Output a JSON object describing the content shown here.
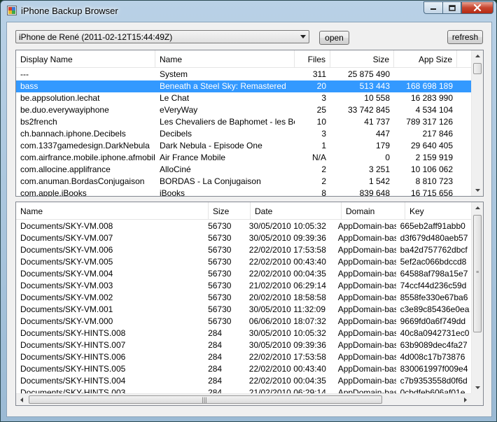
{
  "window": {
    "title": "iPhone Backup Browser"
  },
  "toolbar": {
    "backup_selected": "iPhone de René (2011-02-12T15:44:49Z)",
    "open_label": "open",
    "refresh_label": "refresh"
  },
  "apps": {
    "columns": [
      "Display Name",
      "Name",
      "Files",
      "Size",
      "App Size"
    ],
    "rows": [
      [
        "---",
        "System",
        "311",
        "25 875 490",
        ""
      ],
      [
        "bass",
        "Beneath a Steel Sky: Remastered",
        "20",
        "513 443",
        "168 698 189"
      ],
      [
        "be.appsolution.lechat",
        "Le Chat",
        "3",
        "10 558",
        "16 283 990"
      ],
      [
        "be.duo.everywayiphone",
        "eVeryWay",
        "25",
        "33 742 845",
        "4 534 104"
      ],
      [
        "bs2french",
        "Les Chevaliers de Baphomet - les Bo...",
        "10",
        "41 737",
        "789 317 126"
      ],
      [
        "ch.bannach.iphone.Decibels",
        "Decibels",
        "3",
        "447",
        "217 846"
      ],
      [
        "com.1337gamedesign.DarkNebula",
        "Dark Nebula - Episode One",
        "1",
        "179",
        "29 640 405"
      ],
      [
        "com.airfrance.mobile.iphone.afmobile",
        "Air France Mobile",
        "N/A",
        "0",
        "2 159 919"
      ],
      [
        "com.allocine.applifrance",
        "AlloCiné",
        "2",
        "3 251",
        "10 106 062"
      ],
      [
        "com.anuman.BordasConjugaison",
        "BORDAS - La Conjugaison",
        "2",
        "1 542",
        "8 810 723"
      ],
      [
        "com.apple.iBooks",
        "iBooks",
        "8",
        "839 648",
        "16 715 656"
      ]
    ],
    "selected_index": 1
  },
  "files": {
    "columns": [
      "Name",
      "Size",
      "Date",
      "Domain",
      "Key"
    ],
    "rows": [
      [
        "Documents/SKY-VM.008",
        "56730",
        "30/05/2010 10:05:32",
        "AppDomain-bass",
        "665eb2aff91abb0"
      ],
      [
        "Documents/SKY-VM.007",
        "56730",
        "30/05/2010 09:39:36",
        "AppDomain-bass",
        "d3f679d480aeb57"
      ],
      [
        "Documents/SKY-VM.006",
        "56730",
        "22/02/2010 17:53:58",
        "AppDomain-bass",
        "ba42d757762dbcf"
      ],
      [
        "Documents/SKY-VM.005",
        "56730",
        "22/02/2010 00:43:40",
        "AppDomain-bass",
        "5ef2ac066bdccd8"
      ],
      [
        "Documents/SKY-VM.004",
        "56730",
        "22/02/2010 00:04:35",
        "AppDomain-bass",
        "64588af798a15e7"
      ],
      [
        "Documents/SKY-VM.003",
        "56730",
        "21/02/2010 06:29:14",
        "AppDomain-bass",
        "74ccf44d236c59d"
      ],
      [
        "Documents/SKY-VM.002",
        "56730",
        "20/02/2010 18:58:58",
        "AppDomain-bass",
        "8558fe330e67ba6"
      ],
      [
        "Documents/SKY-VM.001",
        "56730",
        "30/05/2010 11:32:09",
        "AppDomain-bass",
        "c3e89c85436e0ea"
      ],
      [
        "Documents/SKY-VM.000",
        "56730",
        "06/06/2010 18:07:32",
        "AppDomain-bass",
        "9669fd0a6f749dd"
      ],
      [
        "Documents/SKY-HINTS.008",
        "284",
        "30/05/2010 10:05:32",
        "AppDomain-bass",
        "40c8a0942731ec0"
      ],
      [
        "Documents/SKY-HINTS.007",
        "284",
        "30/05/2010 09:39:36",
        "AppDomain-bass",
        "63b9089dec4fa27"
      ],
      [
        "Documents/SKY-HINTS.006",
        "284",
        "22/02/2010 17:53:58",
        "AppDomain-bass",
        "4d008c17b73876"
      ],
      [
        "Documents/SKY-HINTS.005",
        "284",
        "22/02/2010 00:43:40",
        "AppDomain-bass",
        "830061997f009e4"
      ],
      [
        "Documents/SKY-HINTS.004",
        "284",
        "22/02/2010 00:04:35",
        "AppDomain-bass",
        "c7b9353558d0f6d"
      ],
      [
        "Documents/SKY-HINTS.003",
        "284",
        "21/02/2010 06:29:14",
        "AppDomain-bass",
        "0cbdfeb606af01e"
      ]
    ]
  },
  "colors": {
    "selection": "#3399ff",
    "close_button": "#c7452f"
  }
}
